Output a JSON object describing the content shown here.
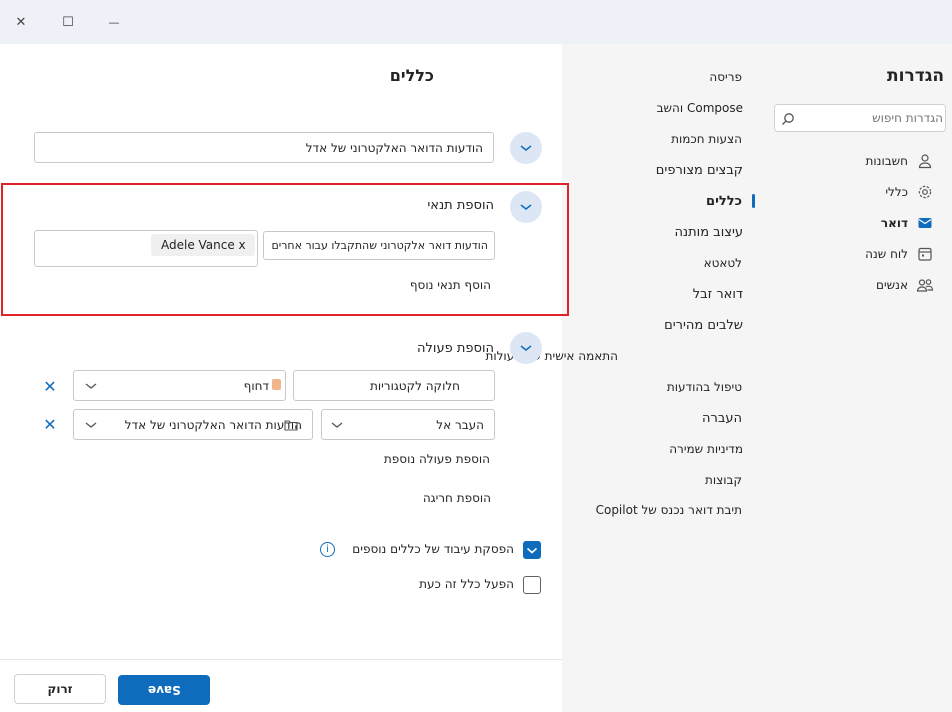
{
  "window": {
    "close_label": "✕",
    "maximize_label": "☐",
    "minimize_label": "—"
  },
  "settings": {
    "title": "הגדרות",
    "search_placeholder": "הגדרות חיפוש",
    "nav": [
      {
        "label": "חשבונות",
        "icon": "person-icon"
      },
      {
        "label": "כללי",
        "icon": "gear-icon"
      },
      {
        "label": "דואר",
        "icon": "mail-icon"
      },
      {
        "label": "לוח שנה",
        "icon": "calendar-icon"
      },
      {
        "label": "אנשים",
        "icon": "people-icon"
      }
    ],
    "categories": [
      "פריסה",
      "Compose והשב",
      "הצעות חכמות",
      "קבצים מצורפים",
      "כללים",
      "עיצוב מותנה",
      "לטאטא",
      "דואר זבל",
      "שלבים מהירים",
      "התאמה אישית של פעולות",
      "טיפול בהודעות",
      "העברה",
      "מדיניות שמירה",
      "קבוצות",
      "תיבת דואר נכנס של Copilot"
    ]
  },
  "rules": {
    "title": "כללים",
    "rule_name": "הודעות הדואר האלקטרוני של אדל",
    "condition_header": "הוספת תנאי",
    "condition_select": "הודעות דואר אלקטרוני שהתקבלו עבור אחרים",
    "condition_chip": "Adele Vance x",
    "add_condition": "הוסף תנאי נוסף",
    "action_header": "הוספת פעולה",
    "action1_select": "חלוקה לקטגוריות",
    "action1_value": "דחוף",
    "action2_select": "העבר אל",
    "action2_value": "הודעות הדואר האלקטרוני של אדל",
    "add_action": "הוספת פעולה נוספת",
    "add_exception": "הוספת חריגה",
    "stop_processing": "הפסקת עיבוד של כללים נוספים",
    "run_now": "הפעל כלל זה כעת",
    "save_label": "Save",
    "discard_label": "זרוק"
  },
  "colors": {
    "accent": "#0f6cbd",
    "highlight_border": "#e12229",
    "chevron_bg": "#dce6f5"
  }
}
